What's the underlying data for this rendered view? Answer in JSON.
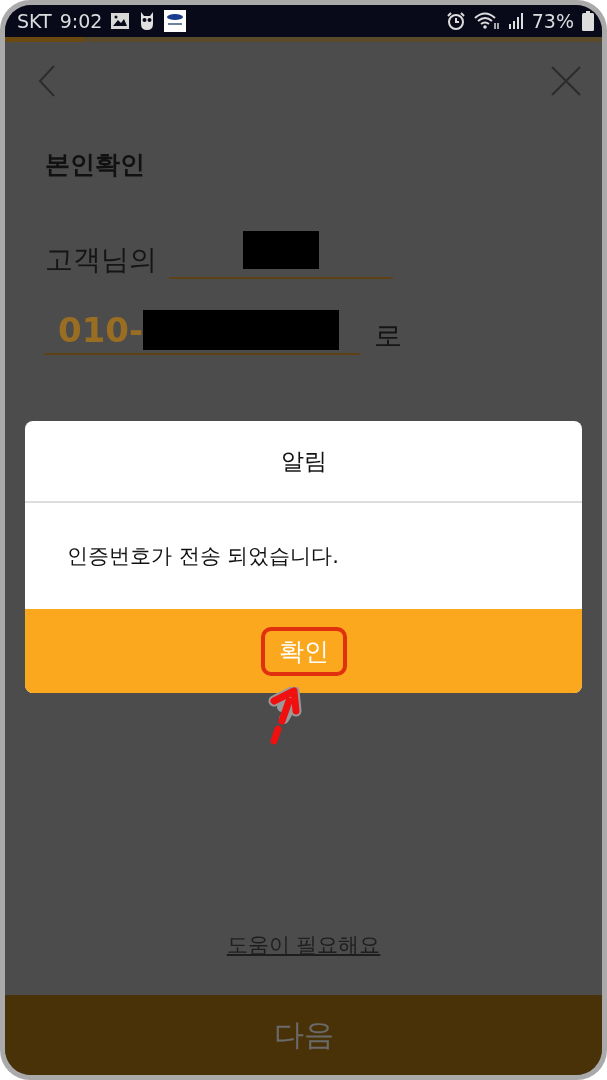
{
  "status_bar": {
    "carrier": "SKT",
    "time": "9:02",
    "battery": "73%"
  },
  "progress": {
    "level": 0.13
  },
  "title": "본인확인",
  "name_row": {
    "label": "고객님의"
  },
  "phone_row": {
    "value": "010-",
    "suffix": "로"
  },
  "dialog": {
    "title": "알림",
    "message": "인증번호가 전송 되었습니다.",
    "button": "확인"
  },
  "help_link": "도움이 필요해요",
  "next_button": {
    "label": "다음",
    "disabled": true
  }
}
